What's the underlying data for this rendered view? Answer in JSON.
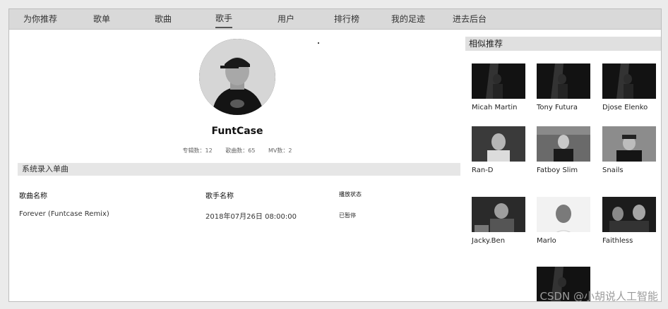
{
  "nav": {
    "items": [
      {
        "label": "为你推荐"
      },
      {
        "label": "歌单"
      },
      {
        "label": "歌曲"
      },
      {
        "label": "歌手",
        "active": true
      },
      {
        "label": "用户"
      },
      {
        "label": "排行榜"
      },
      {
        "label": "我的足迹"
      },
      {
        "label": "进去后台"
      }
    ]
  },
  "artist": {
    "name": "FuntCase",
    "albums": "专辑数：12",
    "songs": "歌曲数：65",
    "mvs": "MV数：2"
  },
  "singles": {
    "section_title": "系统录入单曲",
    "columns": [
      "歌曲名称",
      "歌手名称",
      "播放状态"
    ],
    "rows": [
      {
        "song": "Forever (Funtcase Remix)",
        "time": "2018年07月26日 08:00:00",
        "status": "已暂停"
      }
    ]
  },
  "similar": {
    "title": "相似推荐",
    "artists": [
      {
        "name": "Micah Martin"
      },
      {
        "name": "Tony Futura"
      },
      {
        "name": "Djose Elenko"
      },
      {
        "name": "Ran-D"
      },
      {
        "name": "Fatboy Slim"
      },
      {
        "name": "Snails"
      },
      {
        "name": "Jacky.Ben"
      },
      {
        "name": "Marlo"
      },
      {
        "name": "Faithless"
      },
      {
        "name": ""
      }
    ]
  },
  "watermark": "CSDN @小胡说人工智能"
}
